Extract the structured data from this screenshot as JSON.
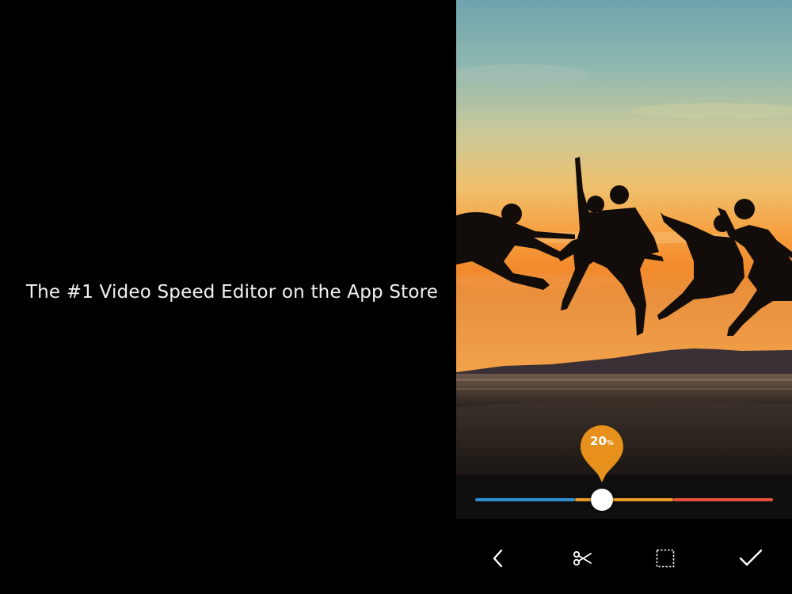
{
  "tagline": "The #1 Video Speed Editor on the App Store",
  "speed": {
    "value_text": "20",
    "unit": "%",
    "level_fraction": 0.42
  },
  "toolbar": {
    "back": "chevron-left-icon",
    "trim": "scissors-icon",
    "crop": "crop-frame-icon",
    "done": "checkmark-icon"
  },
  "colors": {
    "track_blue": "#2e8fd0",
    "track_orange": "#eb9a25",
    "track_red": "#e9503e",
    "pin": "#e8901c"
  }
}
